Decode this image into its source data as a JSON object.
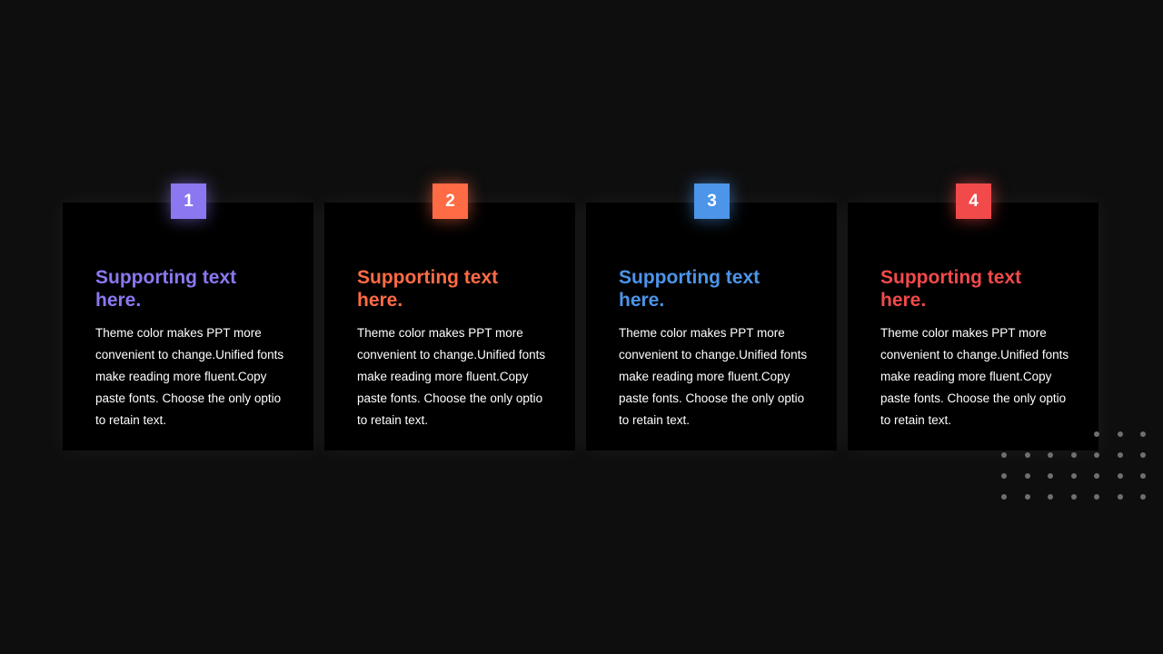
{
  "accent_colors": [
    "#8b78f0",
    "#ff6b45",
    "#4c95e8",
    "#f24a4a"
  ],
  "cards": [
    {
      "number": "1",
      "color": "#8b78f0",
      "title": "Supporting text here.",
      "body": "Theme color makes PPT more convenient to change.Unified fonts make reading more fluent.Copy paste fonts. Choose the only optio to retain text."
    },
    {
      "number": "2",
      "color": "#ff6b45",
      "title": "Supporting text here.",
      "body": "Theme color makes PPT more convenient to change.Unified fonts make reading more fluent.Copy paste fonts. Choose the only optio to retain text."
    },
    {
      "number": "3",
      "color": "#4c95e8",
      "title": "Supporting text here.",
      "body": "Theme color makes PPT more convenient to change.Unified fonts make reading more fluent.Copy paste fonts. Choose the only optio to retain text."
    },
    {
      "number": "4",
      "color": "#f24a4a",
      "title": "Supporting text here.",
      "body": "Theme color makes PPT more convenient to change.Unified fonts make reading more fluent.Copy paste fonts. Choose the only optio to retain text."
    }
  ],
  "decoration": {
    "icon": "dot-grid-icon",
    "color": "#6f6f6f"
  }
}
